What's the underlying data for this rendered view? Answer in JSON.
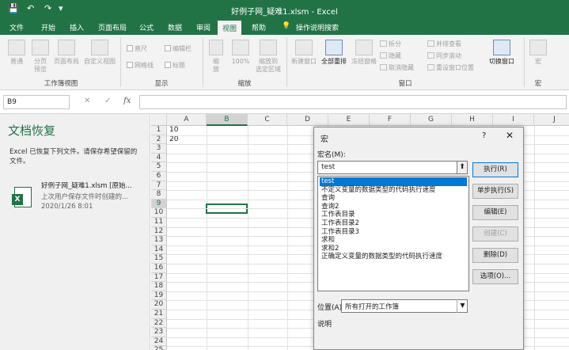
{
  "window": {
    "title": "好例子网_疑难1.xlsm  -  Excel",
    "quick_access": {
      "save": "💾",
      "undo": "↶",
      "redo": "↷",
      "customize": "▾"
    },
    "controls": [
      "▭",
      "—",
      "□",
      "✕"
    ]
  },
  "ribbon": {
    "tabs": [
      "文件",
      "开始",
      "插入",
      "页面布局",
      "公式",
      "数据",
      "审阅",
      "视图",
      "帮助",
      "操作说明搜索"
    ],
    "active_tab": "视图",
    "groups": {
      "workbook_views": {
        "label": "工作簿视图",
        "buttons": [
          "普通",
          "分页\n预览",
          "页面布局",
          "自定义视图"
        ]
      },
      "show": {
        "label": "显示",
        "checks": [
          "直尺",
          "编辑栏",
          "网格线",
          "标题"
        ]
      },
      "zoom": {
        "label": "缩放",
        "buttons": [
          "缩\n放",
          "100%",
          "缩放到\n选定区域"
        ]
      },
      "window": {
        "label": "窗口",
        "buttons": [
          "新建窗口",
          "全部重排",
          "冻结窗格"
        ],
        "small": [
          "拆分",
          "隐藏",
          "取消隐藏",
          "并排查看",
          "同步滚动",
          "重设窗口位置"
        ],
        "switch": "切换窗口"
      },
      "macro": {
        "label": "宏",
        "button": "宏"
      }
    }
  },
  "formula_bar": {
    "name_box": "B9",
    "cancel": "✕",
    "enter": "✓",
    "fx": "fx",
    "value": ""
  },
  "recovery": {
    "title": "文档恢复",
    "description": "Excel 已恢复下列文件。请保存希望保留的文件。",
    "file": {
      "name": "好例子网_疑难1.xlsm  [原始...",
      "note": "上次用户保存文件时创建的...",
      "date": "2020/1/26 8:01"
    }
  },
  "sheet": {
    "columns": [
      "A",
      "B",
      "C",
      "D",
      "E",
      "F",
      "G",
      "H",
      "I",
      "J"
    ],
    "rows": [
      "1",
      "2",
      "3",
      "4",
      "5",
      "6",
      "7",
      "8",
      "9",
      "10",
      "11",
      "12",
      "13",
      "14",
      "15",
      "16",
      "17",
      "18",
      "19",
      "20",
      "21",
      "22",
      "23",
      "24",
      "25"
    ],
    "selected_cell": "B9",
    "cells": {
      "A1": "10",
      "A2": "20"
    }
  },
  "macro_dialog": {
    "title": "宏",
    "help": "?",
    "close": "✕",
    "name_label": "宏名(M):",
    "name_value": "test",
    "up_arrow": "⬆",
    "macros": [
      "test",
      "不定义变量的数据类型的代码执行速度",
      "查询",
      "查询2",
      "工作表目录",
      "工作表目录2",
      "工作表目录3",
      "求和",
      "求和2",
      "正确定义变量的数据类型的代码执行速度"
    ],
    "selected_macro": "test",
    "buttons": [
      "执行(R)",
      "单步执行(S)",
      "编辑(E)",
      "创建(C)",
      "删除(D)",
      "选项(O)..."
    ],
    "location_label": "位置(A):",
    "location_value": "所有打开的工作簿",
    "description_label": "说明"
  }
}
